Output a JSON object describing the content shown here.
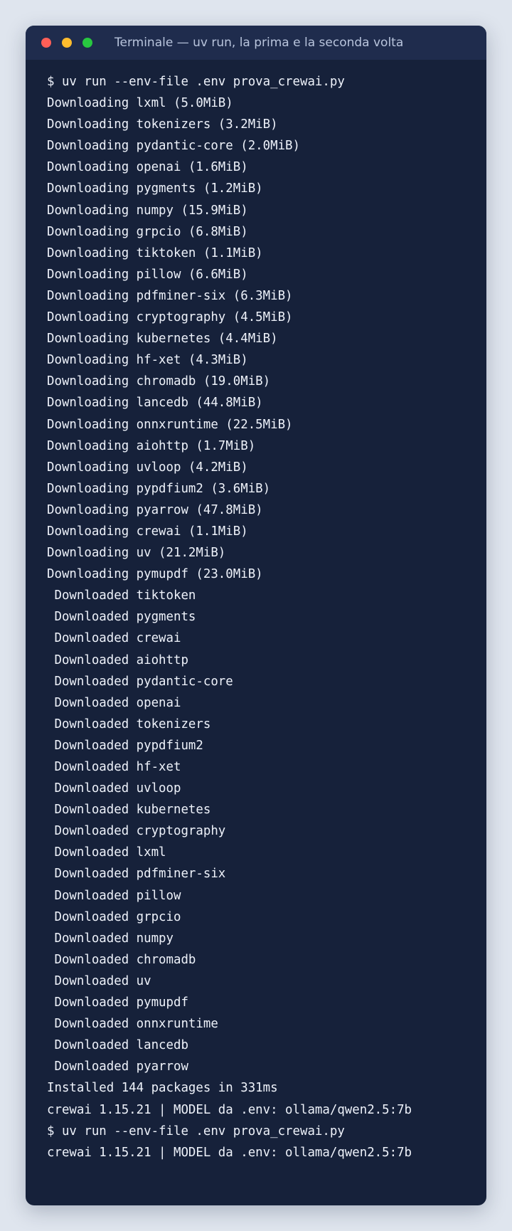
{
  "window": {
    "title": "Terminale — uv run, la prima e la seconda volta",
    "colors": {
      "background": "#16213a",
      "titlebar": "#1f2c4d",
      "text": "#eef2fa",
      "close": "#ff5f57",
      "minimize": "#febc2e",
      "maximize": "#28c840"
    }
  },
  "terminal": {
    "lines": [
      "$ uv run --env-file .env prova_crewai.py",
      "Downloading lxml (5.0MiB)",
      "Downloading tokenizers (3.2MiB)",
      "Downloading pydantic-core (2.0MiB)",
      "Downloading openai (1.6MiB)",
      "Downloading pygments (1.2MiB)",
      "Downloading numpy (15.9MiB)",
      "Downloading grpcio (6.8MiB)",
      "Downloading tiktoken (1.1MiB)",
      "Downloading pillow (6.6MiB)",
      "Downloading pdfminer-six (6.3MiB)",
      "Downloading cryptography (4.5MiB)",
      "Downloading kubernetes (4.4MiB)",
      "Downloading hf-xet (4.3MiB)",
      "Downloading chromadb (19.0MiB)",
      "Downloading lancedb (44.8MiB)",
      "Downloading onnxruntime (22.5MiB)",
      "Downloading aiohttp (1.7MiB)",
      "Downloading uvloop (4.2MiB)",
      "Downloading pypdfium2 (3.6MiB)",
      "Downloading pyarrow (47.8MiB)",
      "Downloading crewai (1.1MiB)",
      "Downloading uv (21.2MiB)",
      "Downloading pymupdf (23.0MiB)",
      " Downloaded tiktoken",
      " Downloaded pygments",
      " Downloaded crewai",
      " Downloaded aiohttp",
      " Downloaded pydantic-core",
      " Downloaded openai",
      " Downloaded tokenizers",
      " Downloaded pypdfium2",
      " Downloaded hf-xet",
      " Downloaded uvloop",
      " Downloaded kubernetes",
      " Downloaded cryptography",
      " Downloaded lxml",
      " Downloaded pdfminer-six",
      " Downloaded pillow",
      " Downloaded grpcio",
      " Downloaded numpy",
      " Downloaded chromadb",
      " Downloaded uv",
      " Downloaded pymupdf",
      " Downloaded onnxruntime",
      " Downloaded lancedb",
      " Downloaded pyarrow",
      "Installed 144 packages in 331ms",
      "crewai 1.15.21 | MODEL da .env: ollama/qwen2.5:7b",
      "$ uv run --env-file .env prova_crewai.py",
      "crewai 1.15.21 | MODEL da .env: ollama/qwen2.5:7b"
    ]
  }
}
